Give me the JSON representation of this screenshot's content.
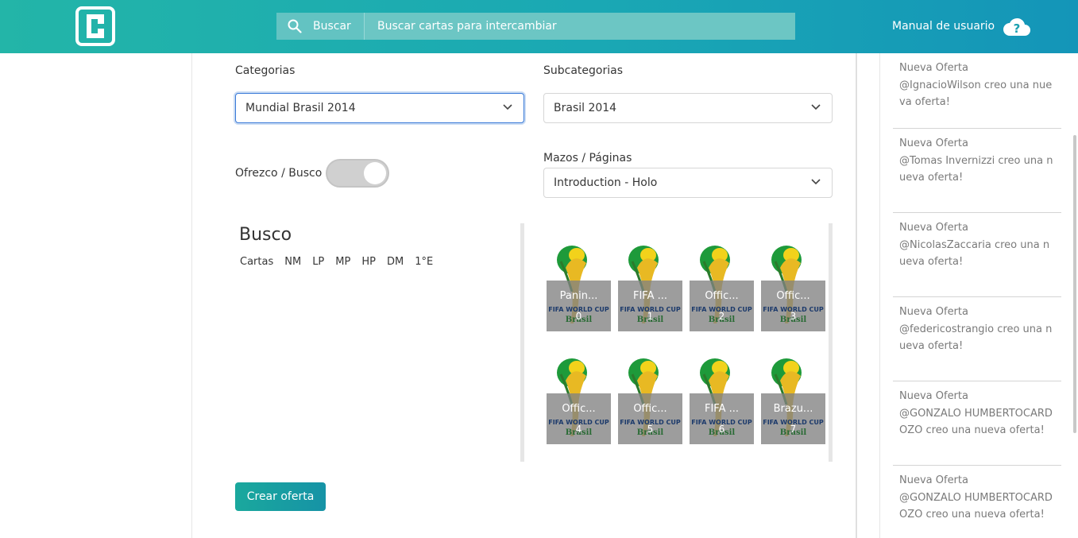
{
  "header": {
    "search_button_label": "Buscar",
    "search_placeholder": "Buscar cartas para intercambiar",
    "manual_label": "Manual de usuario"
  },
  "form": {
    "categorias_label": "Categorias",
    "categorias_value": "Mundial Brasil 2014",
    "subcategorias_label": "Subcategorias",
    "subcategorias_value": "Brasil 2014",
    "toggle_label": "Ofrezco / Busco",
    "mazos_label": "Mazos / Páginas",
    "mazos_value": "Introduction - Holo"
  },
  "busco": {
    "title": "Busco",
    "columns": [
      "Cartas",
      "NM",
      "LP",
      "MP",
      "HP",
      "DM",
      "1°E"
    ]
  },
  "cards": [
    {
      "title": "Panin...",
      "index": "0"
    },
    {
      "title": "FIFA ...",
      "index": "1"
    },
    {
      "title": "Offic...",
      "index": "2"
    },
    {
      "title": "Offic...",
      "index": "3"
    },
    {
      "title": "Offic...",
      "index": "4"
    },
    {
      "title": "Offic...",
      "index": "5"
    },
    {
      "title": "FIFA ...",
      "index": "6"
    },
    {
      "title": "Brazu...",
      "index": "7"
    }
  ],
  "card_brand": {
    "line1": "FIFA WORLD CUP",
    "line2": "Brasil"
  },
  "create_button": "Crear oferta",
  "feed": [
    {
      "title": "Nueva Oferta",
      "text": "@IgnacioWilson creo una nueva oferta!"
    },
    {
      "title": "Nueva Oferta",
      "text": "@Tomas Invernizzi creo una nueva oferta!"
    },
    {
      "title": "Nueva Oferta",
      "text": "@NicolasZaccaria creo una nueva oferta!"
    },
    {
      "title": "Nueva Oferta",
      "text": "@federicostrangio creo una nueva oferta!"
    },
    {
      "title": "Nueva Oferta",
      "text": "@GONZALO HUMBERTOCARDOZO creo una nueva oferta!"
    },
    {
      "title": "Nueva Oferta",
      "text": "@GONZALO HUMBERTOCARDOZO creo una nueva oferta!"
    }
  ],
  "colors": {
    "accent": "#1aa89d",
    "focus": "#3a7ad8"
  }
}
